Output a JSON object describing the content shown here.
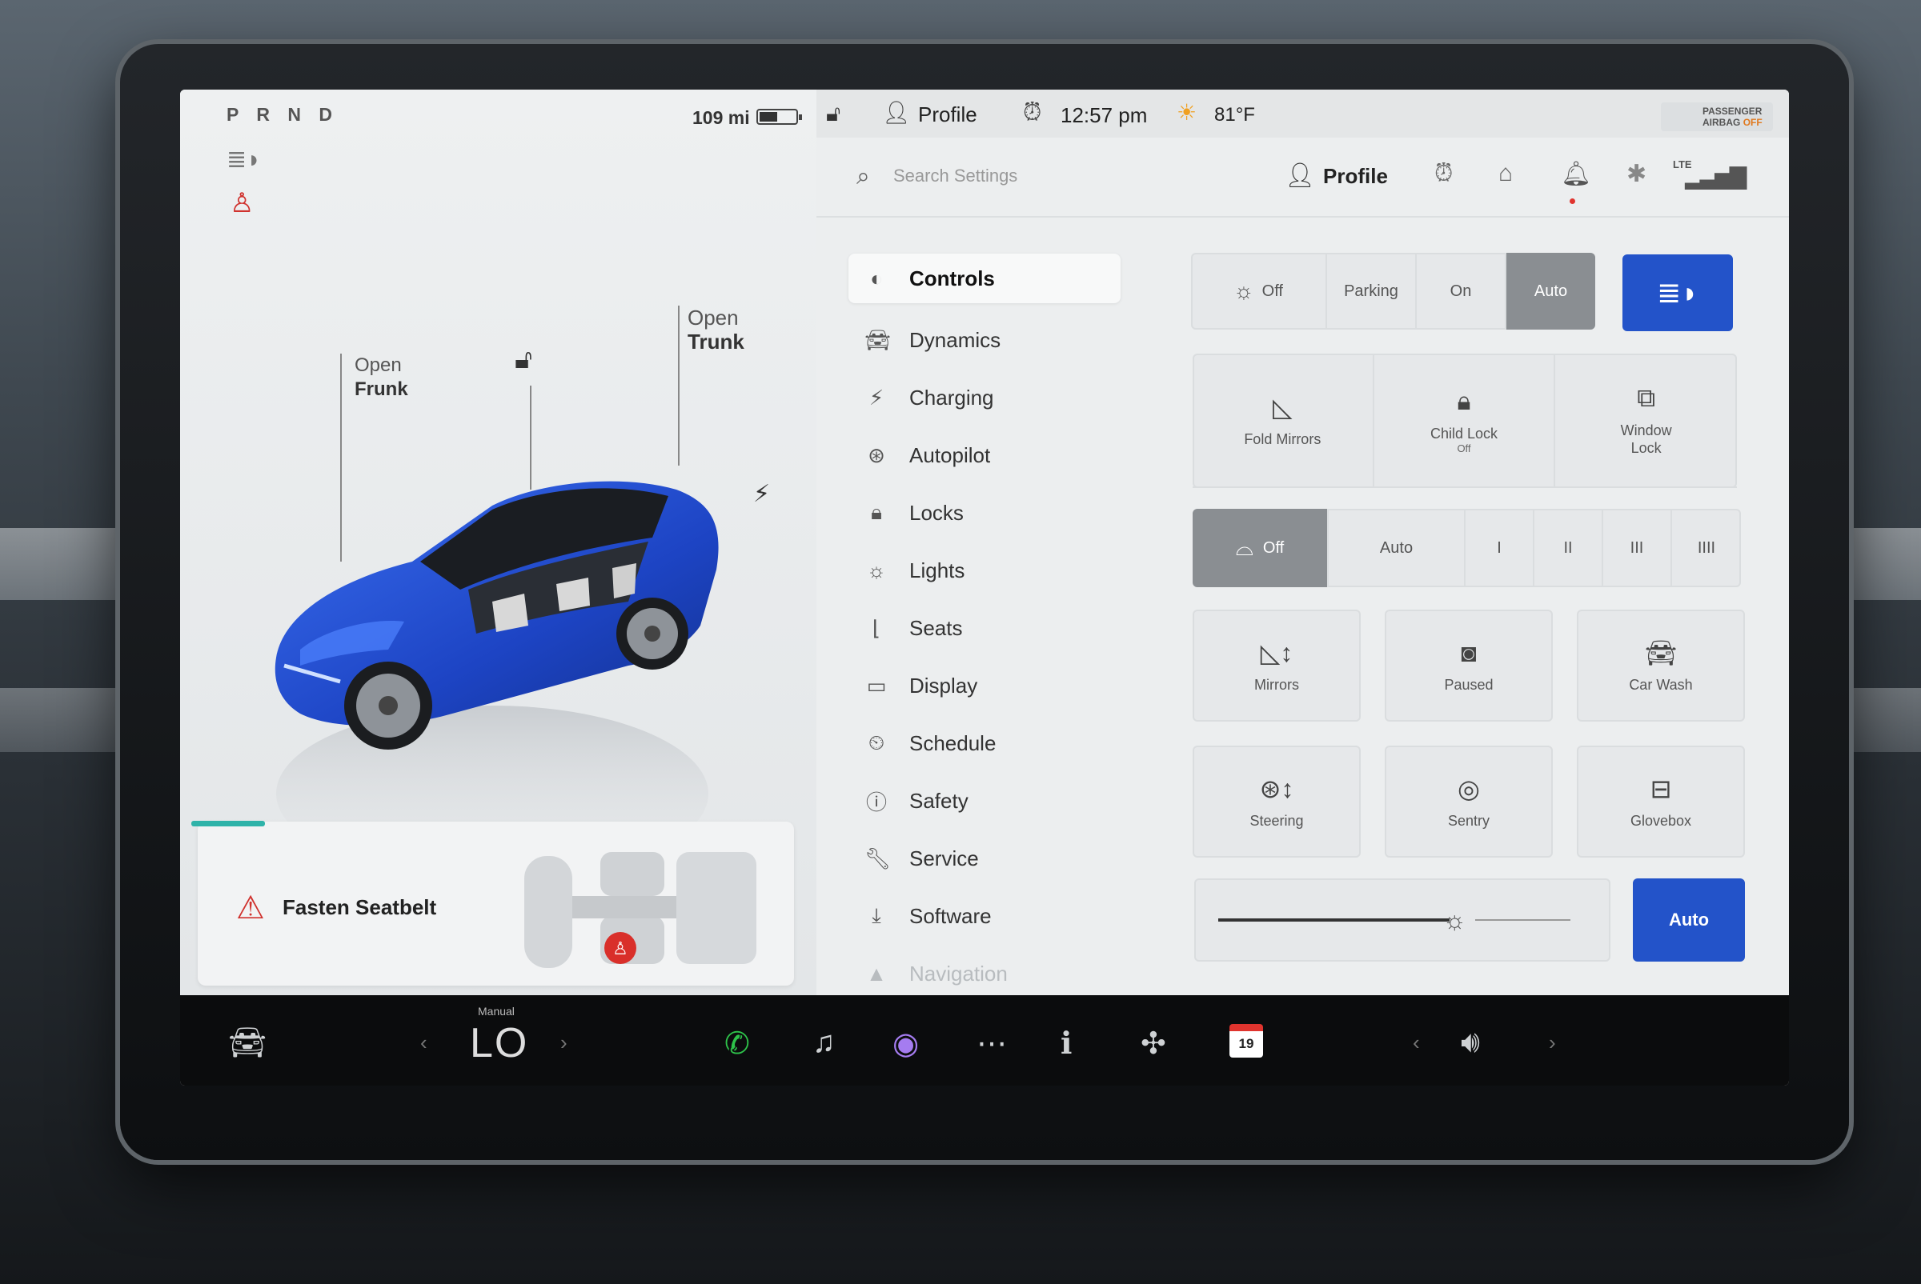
{
  "status": {
    "gear": "P R N D",
    "range": "109 mi",
    "profile": "Profile",
    "time": "12:57 pm",
    "temperature": "81°F",
    "airbag_line1": "PASSENGER",
    "airbag_line2": "AIRBAG",
    "airbag_state": "OFF"
  },
  "car": {
    "frunk_action": "Open",
    "frunk_label": "Frunk",
    "trunk_action": "Open",
    "trunk_label": "Trunk",
    "alert": "Fasten Seatbelt",
    "alert_progress": 0.12
  },
  "search": {
    "placeholder": "Search Settings"
  },
  "toolbar": {
    "profile": "Profile"
  },
  "nav": {
    "items": [
      {
        "label": "Controls",
        "icon": "toggle-icon"
      },
      {
        "label": "Dynamics",
        "icon": "car-icon"
      },
      {
        "label": "Charging",
        "icon": "bolt-icon"
      },
      {
        "label": "Autopilot",
        "icon": "steering-wheel-icon"
      },
      {
        "label": "Locks",
        "icon": "lock-icon"
      },
      {
        "label": "Lights",
        "icon": "light-icon"
      },
      {
        "label": "Seats",
        "icon": "seat-icon"
      },
      {
        "label": "Display",
        "icon": "display-icon"
      },
      {
        "label": "Schedule",
        "icon": "schedule-icon"
      },
      {
        "label": "Safety",
        "icon": "safety-icon"
      },
      {
        "label": "Service",
        "icon": "wrench-icon"
      },
      {
        "label": "Software",
        "icon": "download-icon"
      },
      {
        "label": "Navigation",
        "icon": "navigation-icon"
      }
    ]
  },
  "lights": {
    "off": "Off",
    "parking": "Parking",
    "on": "On",
    "auto": "Auto",
    "selected": "Auto"
  },
  "controls_row": {
    "fold_mirrors": "Fold Mirrors",
    "child_lock": "Child Lock",
    "child_lock_state": "Off",
    "window_lock_1": "Window",
    "window_lock_2": "Lock"
  },
  "wipers": {
    "off": "Off",
    "auto": "Auto",
    "s1": "I",
    "s2": "II",
    "s3": "III",
    "s4": "IIII",
    "selected": "Off"
  },
  "quick": {
    "mirrors": "Mirrors",
    "dashcam": "Paused",
    "car_wash": "Car Wash",
    "steering": "Steering",
    "sentry": "Sentry",
    "glovebox": "Glovebox"
  },
  "display": {
    "brightness": 0.67,
    "auto": "Auto"
  },
  "dock": {
    "temp_mode": "Manual",
    "temp": "LO",
    "calendar_day": "19"
  },
  "colors": {
    "accent": "#2353c9",
    "alert": "#d0322e",
    "progress": "#2fb3a9"
  }
}
